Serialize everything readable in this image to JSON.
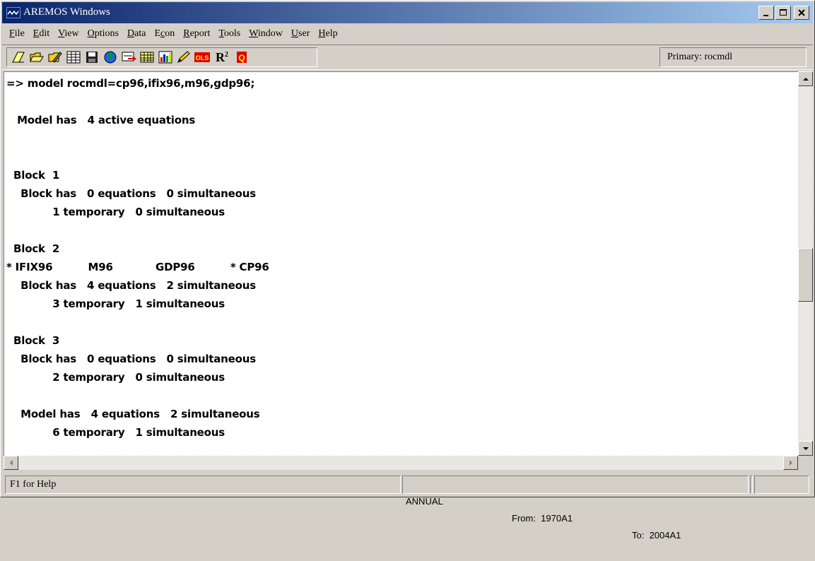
{
  "window": {
    "title": "AREMOS Windows"
  },
  "menu": [
    "File",
    "Edit",
    "View",
    "Options",
    "Data",
    "Econ",
    "Report",
    "Tools",
    "Window",
    "User",
    "Help"
  ],
  "menu_accel_index": [
    0,
    0,
    0,
    0,
    0,
    1,
    0,
    0,
    0,
    0,
    0
  ],
  "toolbar": {
    "buttons": [
      "new-icon",
      "open-icon",
      "edit-icon",
      "series-icon",
      "save-icon",
      "globe-icon",
      "import-icon",
      "table-icon",
      "chart-icon",
      "pencil-icon",
      "ols-icon",
      "r-squared-icon",
      "quit-icon"
    ],
    "ols_label": "OLS",
    "r2_label": "R",
    "r2_sup": "2",
    "q_label": "Q",
    "primary": "Primary: rocmdl"
  },
  "console": {
    "lines": [
      "=> model rocmdl=cp96,ifix96,m96,gdp96;",
      "",
      "   Model has   4 active equations",
      "",
      "",
      "  Block  1",
      "    Block has   0 equations   0 simultaneous",
      "             1 temporary   0 simultaneous",
      "",
      "  Block  2",
      "* IFIX96          M96            GDP96          * CP96",
      "    Block has   4 equations   2 simultaneous",
      "             3 temporary   1 simultaneous",
      "",
      "  Block  3",
      "    Block has   0 equations   0 simultaneous",
      "             2 temporary   0 simultaneous",
      "",
      "    Model has   4 equations   2 simultaneous",
      "             6 temporary   1 simultaneous"
    ]
  },
  "status": {
    "help": "F1 for Help",
    "frequency": "ANNUAL",
    "from": "From:  1970A1",
    "to": "To:  2004A1"
  }
}
